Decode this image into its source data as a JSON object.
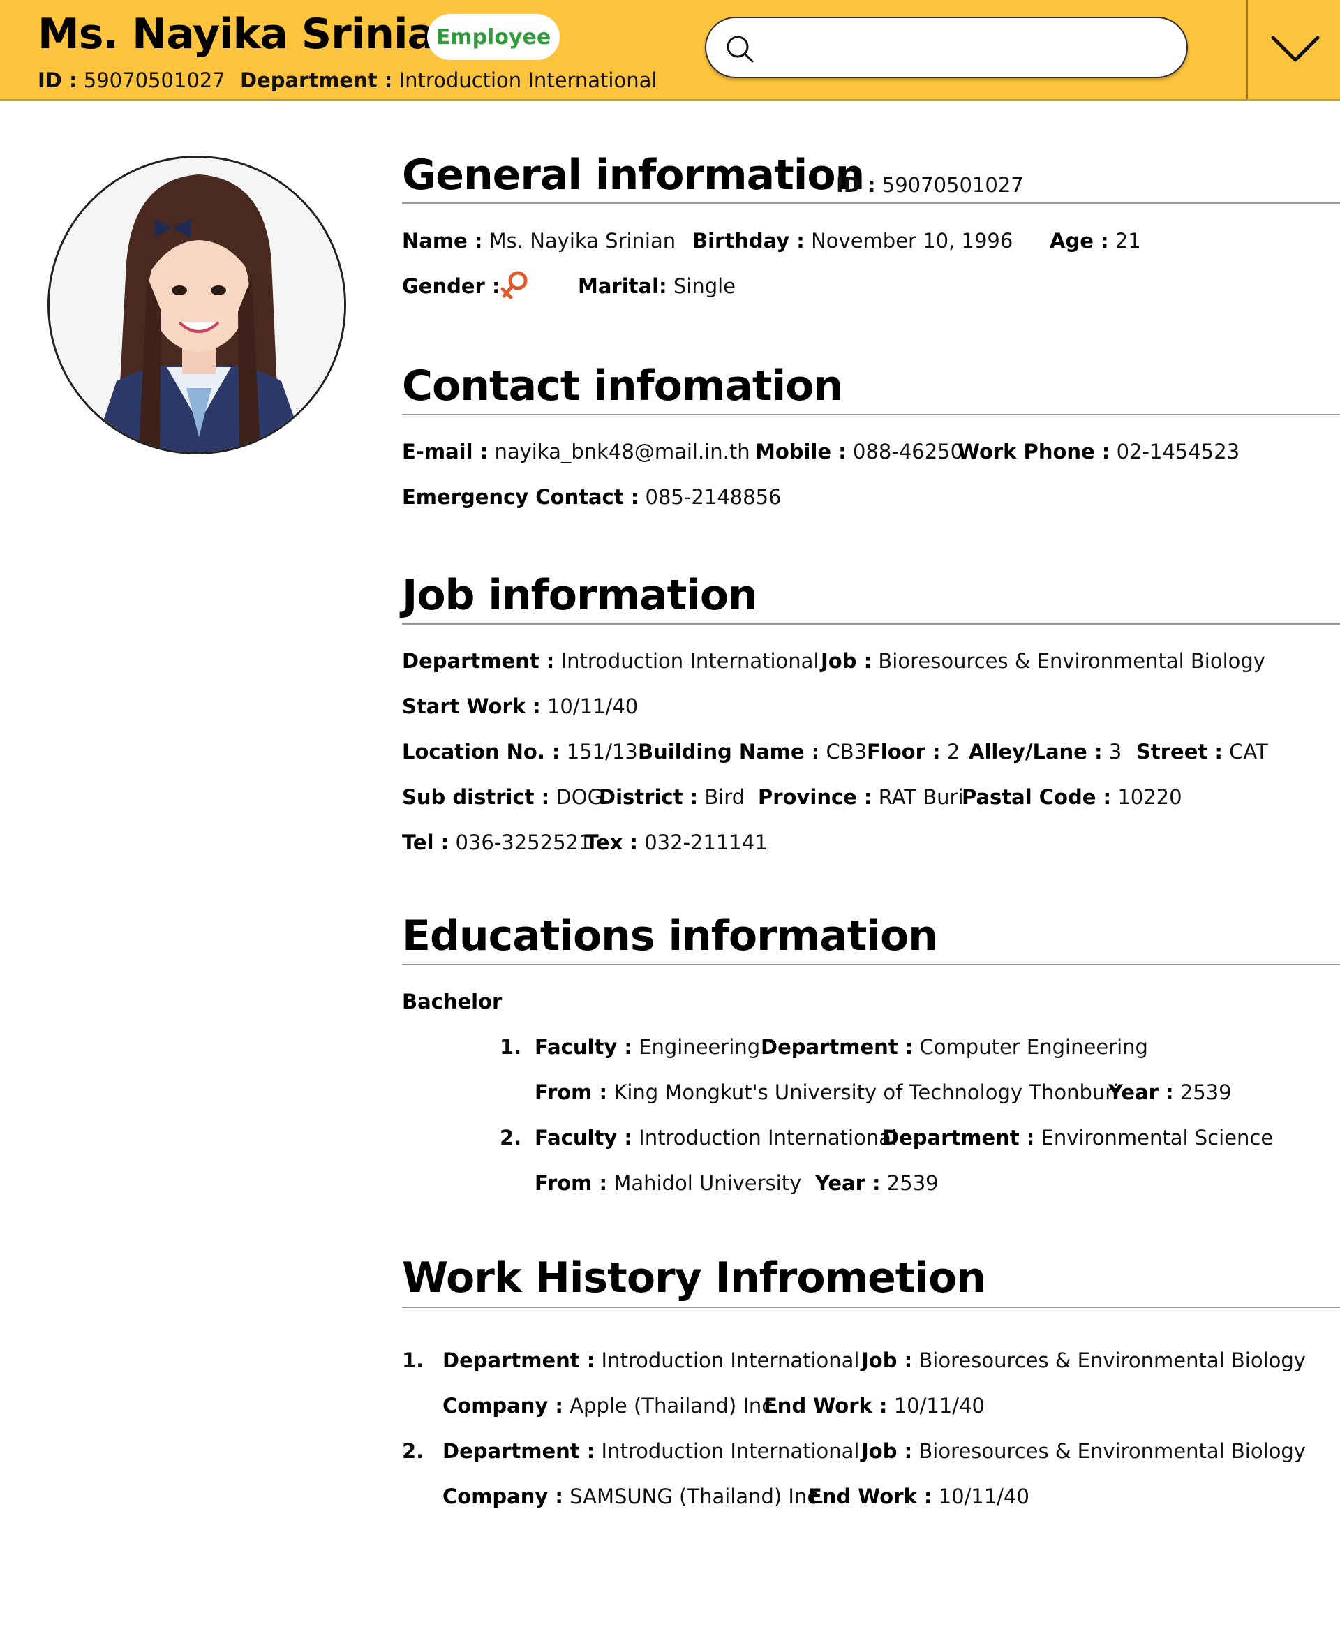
{
  "header": {
    "name": "Ms. Nayika Srinian",
    "badge": "Employee",
    "id_label": "ID :",
    "id_value": "59070501027",
    "dept_label": "Department :",
    "dept_value": "Introduction International",
    "search_placeholder": "",
    "search_icon": "search-icon",
    "menu_icon": "chevron-down-icon"
  },
  "colors": {
    "header_bg": "#ffc43d",
    "badge_text": "#2f9d3a",
    "gender_icon": "#e05a2b"
  },
  "general": {
    "title": "General information",
    "id_label": "ID :",
    "id_value": "59070501027",
    "name_label": "Name :",
    "name_value": "Ms. Nayika Srinian",
    "birthday_label": "Birthday :",
    "birthday_value": "November 10, 1996",
    "age_label": "Age :",
    "age_value": "21",
    "gender_label": "Gender :",
    "gender_icon": "female-symbol-icon",
    "marital_label": "Marital:",
    "marital_value": "Single"
  },
  "contact": {
    "title": "Contact infomation",
    "email_label": "E-mail :",
    "email_value": "nayika_bnk48@mail.in.th",
    "mobile_label": "Mobile :",
    "mobile_value": "088-46250",
    "workphone_label": "Work Phone :",
    "workphone_value": "02-1454523",
    "emergency_label": "Emergency Contact :",
    "emergency_value": "085-2148856"
  },
  "job": {
    "title": "Job information",
    "department_label": "Department :",
    "department_value": "Introduction International",
    "job_label": "Job :",
    "job_value": "Bioresources & Environmental Biology",
    "start_label": "Start Work :",
    "start_value": "10/11/40",
    "location_label": "Location No. :",
    "location_value": "151/13",
    "building_label": "Building Name :",
    "building_value": "CB3",
    "floor_label": "Floor :",
    "floor_value": "2",
    "alley_label": "Alley/Lane :",
    "alley_value": "3",
    "street_label": "Street :",
    "street_value": "CAT",
    "subdistrict_label": "Sub district :",
    "subdistrict_value": "DOG",
    "district_label": "District :",
    "district_value": "Bird",
    "province_label": "Province :",
    "province_value": "RAT Buri",
    "postal_label": "Pastal Code :",
    "postal_value": "10220",
    "tel_label": "Tel :",
    "tel_value": "036-3252521",
    "tex_label": "Tex :",
    "tex_value": "032-211141"
  },
  "education": {
    "title": "Educations information",
    "level": "Bachelor",
    "items": [
      {
        "num": "1.",
        "faculty_label": "Faculty :",
        "faculty_value": "Engineering",
        "department_label": "Department :",
        "department_value": "Computer Engineering",
        "from_label": "From :",
        "from_value": "King Mongkut's University of Technology Thonburi",
        "year_label": "Year :",
        "year_value": "2539"
      },
      {
        "num": "2.",
        "faculty_label": "Faculty :",
        "faculty_value": "Introduction International",
        "department_label": "Department :",
        "department_value": "Environmental Science",
        "from_label": "From :",
        "from_value": "Mahidol University",
        "year_label": "Year :",
        "year_value": "2539"
      }
    ]
  },
  "work": {
    "title": "Work History Infrometion",
    "items": [
      {
        "num": "1.",
        "department_label": "Department :",
        "department_value": "Introduction International",
        "job_label": "Job :",
        "job_value": "Bioresources & Environmental Biology",
        "company_label": "Company :",
        "company_value": "Apple (Thailand) Inc.",
        "end_label": "End Work :",
        "end_value": "10/11/40"
      },
      {
        "num": "2.",
        "department_label": "Department :",
        "department_value": "Introduction International",
        "job_label": "Job :",
        "job_value": "Bioresources & Environmental Biology",
        "company_label": "Company :",
        "company_value": "SAMSUNG (Thailand) Inc.",
        "end_label": "End Work :",
        "end_value": "10/11/40"
      }
    ]
  }
}
